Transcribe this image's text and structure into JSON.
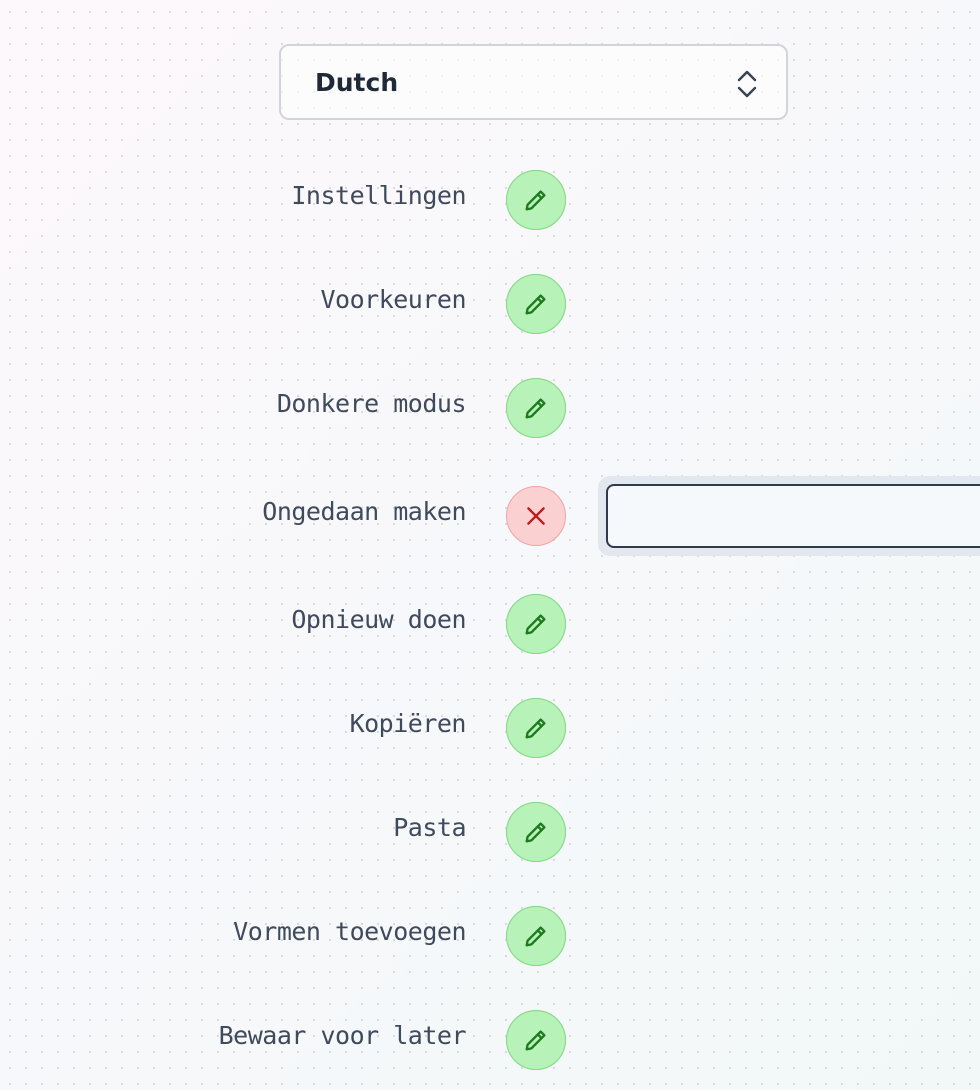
{
  "language_select": {
    "value": "Dutch",
    "icon": "chevron-up-down-icon"
  },
  "rows": [
    {
      "label": "Instellingen",
      "state": "view",
      "action_icon": "pencil-icon"
    },
    {
      "label": "Voorkeuren",
      "state": "view",
      "action_icon": "pencil-icon"
    },
    {
      "label": "Donkere modus",
      "state": "view",
      "action_icon": "pencil-icon"
    },
    {
      "label": "Ongedaan maken",
      "state": "editing",
      "action_icon": "close-icon",
      "input_value": ""
    },
    {
      "label": "Opnieuw doen",
      "state": "view",
      "action_icon": "pencil-icon"
    },
    {
      "label": "Kopiëren",
      "state": "view",
      "action_icon": "pencil-icon"
    },
    {
      "label": "Pasta",
      "state": "view",
      "action_icon": "pencil-icon"
    },
    {
      "label": "Vormen toevoegen",
      "state": "view",
      "action_icon": "pencil-icon"
    },
    {
      "label": "Bewaar voor later",
      "state": "view",
      "action_icon": "pencil-icon"
    }
  ],
  "colors": {
    "edit_button_bg": "#b7f2b8",
    "edit_icon": "#1e7a1e",
    "cancel_button_bg": "#fbd0d0",
    "cancel_icon": "#b91c1c",
    "label_text": "#3f4a5c",
    "input_border": "#2f3a4c"
  }
}
